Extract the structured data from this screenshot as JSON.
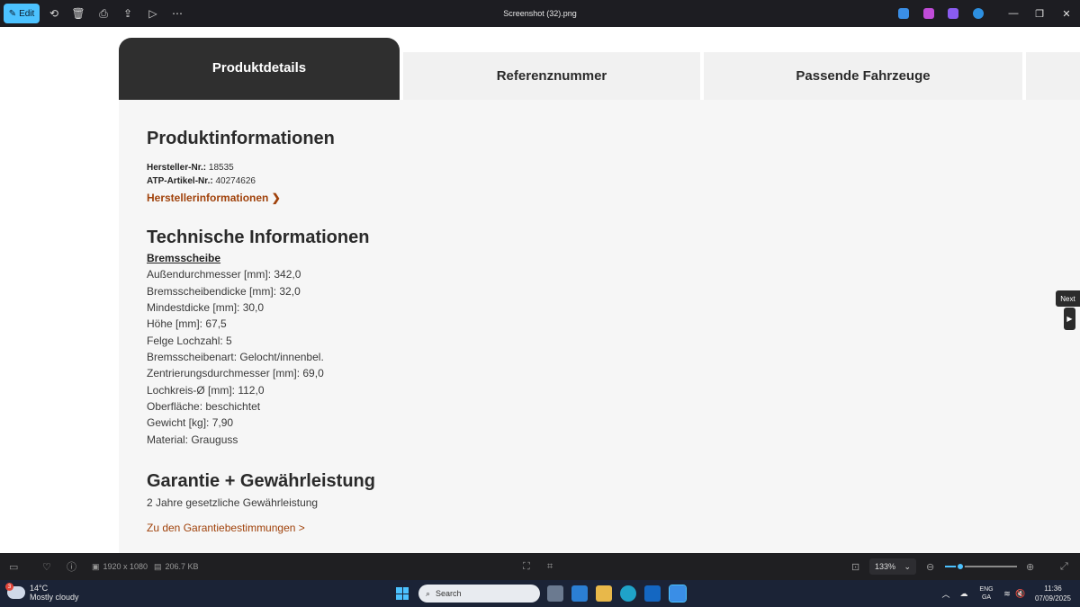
{
  "titlebar": {
    "edit_label": "Edit",
    "title": "Screenshot (32).png",
    "icons": [
      "edit-icon",
      "rotate-icon",
      "delete-icon",
      "print-icon",
      "share-icon",
      "slideshow-icon",
      "more-icon"
    ]
  },
  "tabs": [
    {
      "label": "Produktdetails",
      "active": true
    },
    {
      "label": "Referenznummer",
      "active": false
    },
    {
      "label": "Passende Fahrzeuge",
      "active": false
    }
  ],
  "product_info": {
    "heading": "Produktinformationen",
    "manufacturer_no_label": "Hersteller-Nr.:",
    "manufacturer_no_value": "18535",
    "atp_no_label": "ATP-Artikel-Nr.:",
    "atp_no_value": "40274626",
    "manufacturer_link": "Herstellerinformationen"
  },
  "technical": {
    "heading": "Technische Informationen",
    "subheading": "Bremsscheibe",
    "specs": [
      "Außendurchmesser [mm]: 342,0",
      "Bremsscheibendicke [mm]: 32,0",
      "Mindestdicke [mm]: 30,0",
      "Höhe [mm]: 67,5",
      "Felge Lochzahl: 5",
      "Bremsscheibenart: Gelocht/innenbel.",
      "Zentrierungsdurchmesser [mm]: 69,0",
      "Lochkreis-Ø [mm]: 112,0",
      "Oberfläche: beschichtet",
      "Gewicht [kg]: 7,90",
      "Material: Grauguss"
    ]
  },
  "warranty": {
    "heading": "Garantie + Gewährleistung",
    "text": "2 Jahre gesetzliche Gewährleistung",
    "link": "Zu den Garantiebestimmungen >"
  },
  "next_tooltip": "Next",
  "statusbar": {
    "dimensions": "1920 x 1080",
    "filesize": "206.7 KB",
    "zoom": "133%",
    "zoom_level": 0.21
  },
  "taskbar": {
    "weather_temp": "14°C",
    "weather_text": "Mostly cloudy",
    "weather_badge": "3",
    "search_placeholder": "Search",
    "lang_top": "ENG",
    "lang_bottom": "GA",
    "time": "11:36",
    "date": "07/09/2025"
  },
  "colors": {
    "accent": "#4cc2ff",
    "active_tab": "#2f2f2f",
    "link_orange": "#a0420b"
  }
}
